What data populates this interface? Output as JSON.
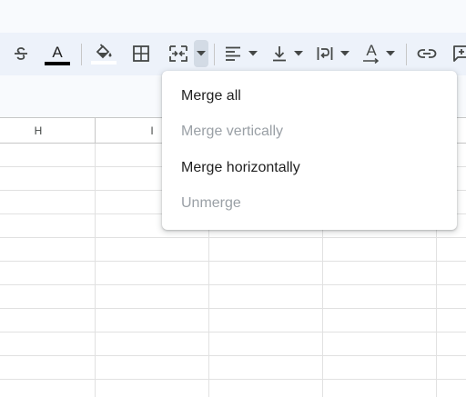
{
  "toolbar": {
    "items": [
      {
        "name": "strikethrough-button",
        "icon": "strikethrough-icon"
      },
      {
        "name": "text-color-button",
        "icon": "text-color-icon",
        "glyph": "A",
        "underline_color": "#000000"
      },
      {
        "name": "fill-color-button",
        "icon": "paint-bucket-icon"
      },
      {
        "name": "borders-button",
        "icon": "borders-icon"
      },
      {
        "name": "merge-cells-button",
        "icon": "merge-cells-icon"
      },
      {
        "name": "merge-cells-dropdown-button",
        "icon": "caret-down-icon",
        "state": "open"
      },
      {
        "name": "horizontal-align-button",
        "icon": "align-left-icon"
      },
      {
        "name": "vertical-align-button",
        "icon": "align-bottom-icon"
      },
      {
        "name": "text-wrapping-button",
        "icon": "text-wrap-icon"
      },
      {
        "name": "text-rotation-button",
        "icon": "text-rotation-icon",
        "glyph": "A"
      },
      {
        "name": "insert-link-button",
        "icon": "link-icon"
      },
      {
        "name": "insert-comment-button",
        "icon": "add-comment-icon"
      }
    ]
  },
  "columns": {
    "h": "H",
    "i": "I"
  },
  "merge_menu": {
    "items": [
      {
        "label": "Merge all",
        "enabled": true
      },
      {
        "label": "Merge vertically",
        "enabled": false
      },
      {
        "label": "Merge horizontally",
        "enabled": true
      },
      {
        "label": "Unmerge",
        "enabled": false
      }
    ]
  },
  "colors": {
    "toolbar_bg": "#edf2fa",
    "icon": "#444746",
    "disabled_text": "#9aa0a6",
    "gridline": "#e1e1e1"
  }
}
